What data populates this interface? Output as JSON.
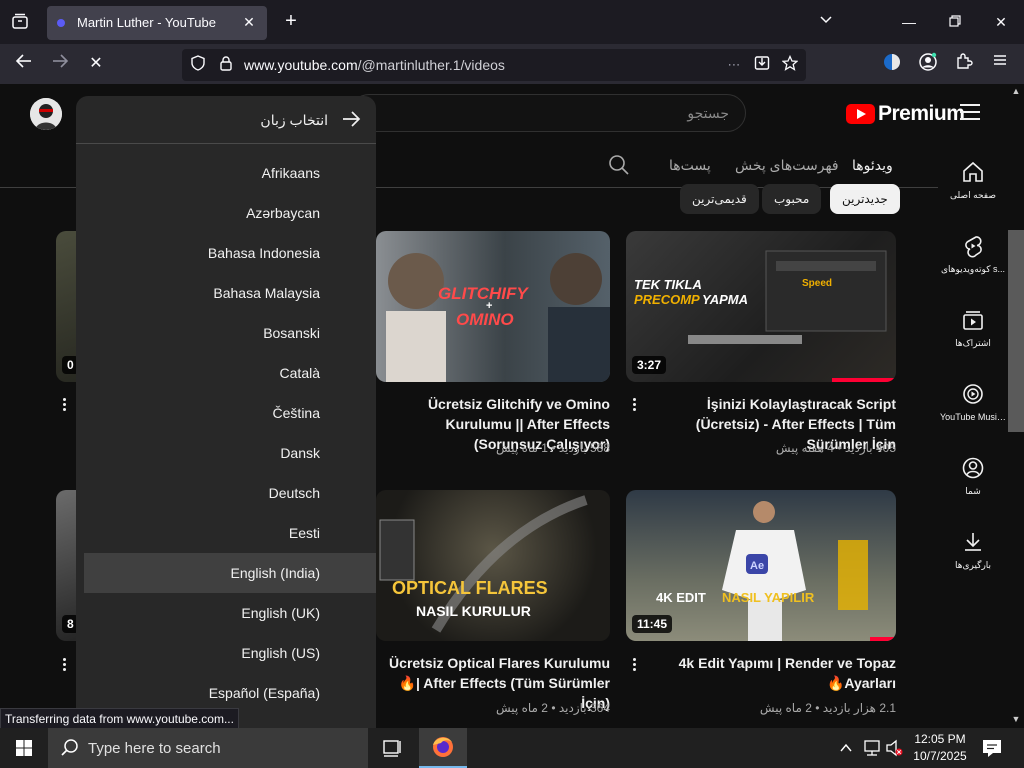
{
  "browser": {
    "tab_title": "Martin Luther - YouTube",
    "url_host": "www.youtube.com",
    "url_path": "/@martinluther.1/videos",
    "status_text": "Transferring data from www.youtube.com..."
  },
  "youtube": {
    "logo_text": "Premium",
    "search_placeholder": "جستجو",
    "guide": [
      {
        "label": "صفحه اصلی",
        "icon": "home-icon"
      },
      {
        "label": "کوته‌ویدیوهای s...",
        "icon": "shorts-icon"
      },
      {
        "label": "اشتراک‌ها",
        "icon": "subscriptions-icon"
      },
      {
        "label": "YouTube Music...",
        "icon": "music-icon"
      },
      {
        "label": "شما",
        "icon": "you-icon"
      },
      {
        "label": "بارگیری‌ها",
        "icon": "downloads-icon"
      }
    ],
    "tabs": [
      "ویدئوها",
      "فهرست‌های پخش",
      "پست‌ها"
    ],
    "chips": [
      "جدیدترین",
      "محبوب",
      "قدیمی‌ترین"
    ],
    "videos": [
      {
        "title": "İşinizi Kolaylaştıracak Script (Ücretsiz) - After Effects | Tüm Sürümler İçin",
        "meta": "405 بازدید • 4 هفته پیش",
        "duration": "3:27",
        "thumb_text": "TEK TIKLA PRECOMP YAPMA"
      },
      {
        "title": "Ücretsiz Glitchify ve Omino Kurulumu || After Effects (Sorunsuz Çalışıyor)",
        "meta": "588 بازدید • 1 ماه پیش",
        "duration": "",
        "thumb_text": "GLITCHIFY + OMINO"
      },
      {
        "title": "4k Edit Yapımı | Render ve Topaz Ayarları🔥",
        "meta": "2.1 هزار بازدید • 2 ماه پیش",
        "duration": "11:45",
        "thumb_text": "4K EDIT NASIL YAPILIR"
      },
      {
        "title": "Ücretsiz Optical Flares Kurulumu 🔥| After Effects (Tüm Sürümler İçin)",
        "meta": "364 بازدید • 2 ماه پیش",
        "duration": "",
        "thumb_text": "OPTICAL FLARES NASIL KURULUR"
      }
    ],
    "left_durations": [
      "0",
      "8"
    ]
  },
  "language_menu": {
    "header": "انتخاب زبان",
    "items": [
      "Afrikaans",
      "Azərbaycan",
      "Bahasa Indonesia",
      "Bahasa Malaysia",
      "Bosanski",
      "Català",
      "Čeština",
      "Dansk",
      "Deutsch",
      "Eesti",
      "English (India)",
      "English (UK)",
      "English (US)",
      "Español (España)"
    ],
    "selected_index": 10
  },
  "taskbar": {
    "search_placeholder": "Type here to search",
    "time": "12:05 PM",
    "date": "10/7/2025"
  },
  "colors": {
    "accent_red": "#ff0000",
    "progress_red": "#ff0033",
    "menu_bg": "#282828"
  }
}
